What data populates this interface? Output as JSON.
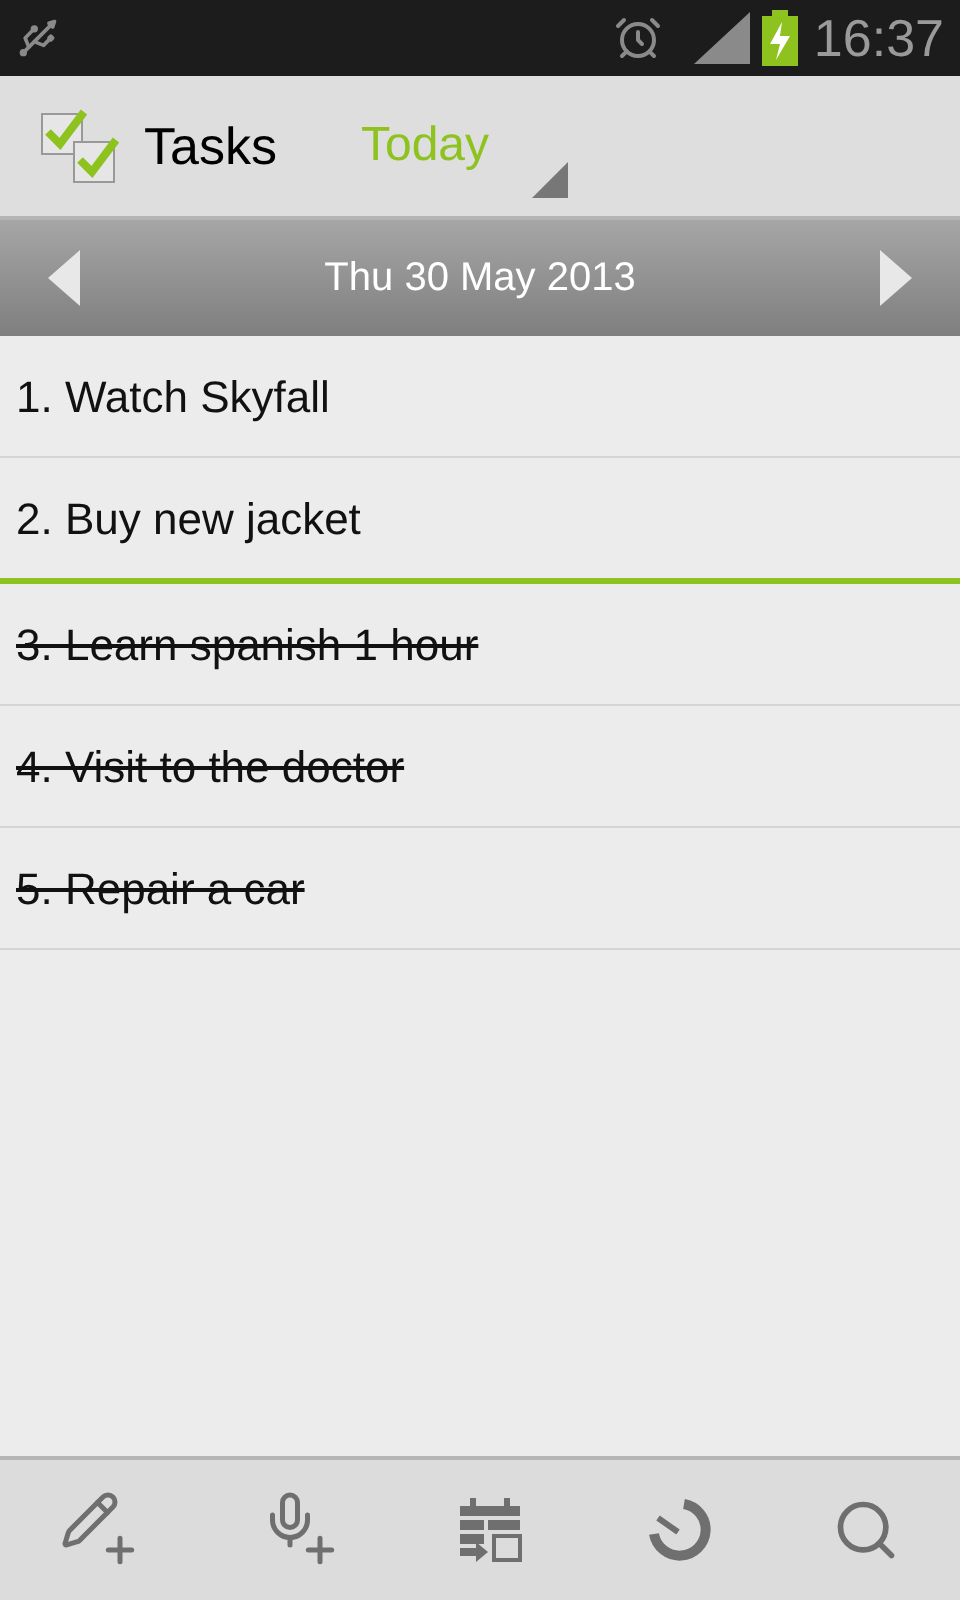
{
  "status_bar": {
    "time": "16:37"
  },
  "action_bar": {
    "title": "Tasks",
    "filter": "Today"
  },
  "date_bar": {
    "date": "Thu 30 May 2013"
  },
  "tasks": [
    {
      "text": "1. Watch Skyfall",
      "done": false
    },
    {
      "text": "2. Buy new jacket",
      "done": false
    },
    {
      "text": "3. Learn spanish 1 hour",
      "done": true
    },
    {
      "text": "4. Visit to the doctor",
      "done": true
    },
    {
      "text": "5. Repair a car",
      "done": true
    }
  ]
}
